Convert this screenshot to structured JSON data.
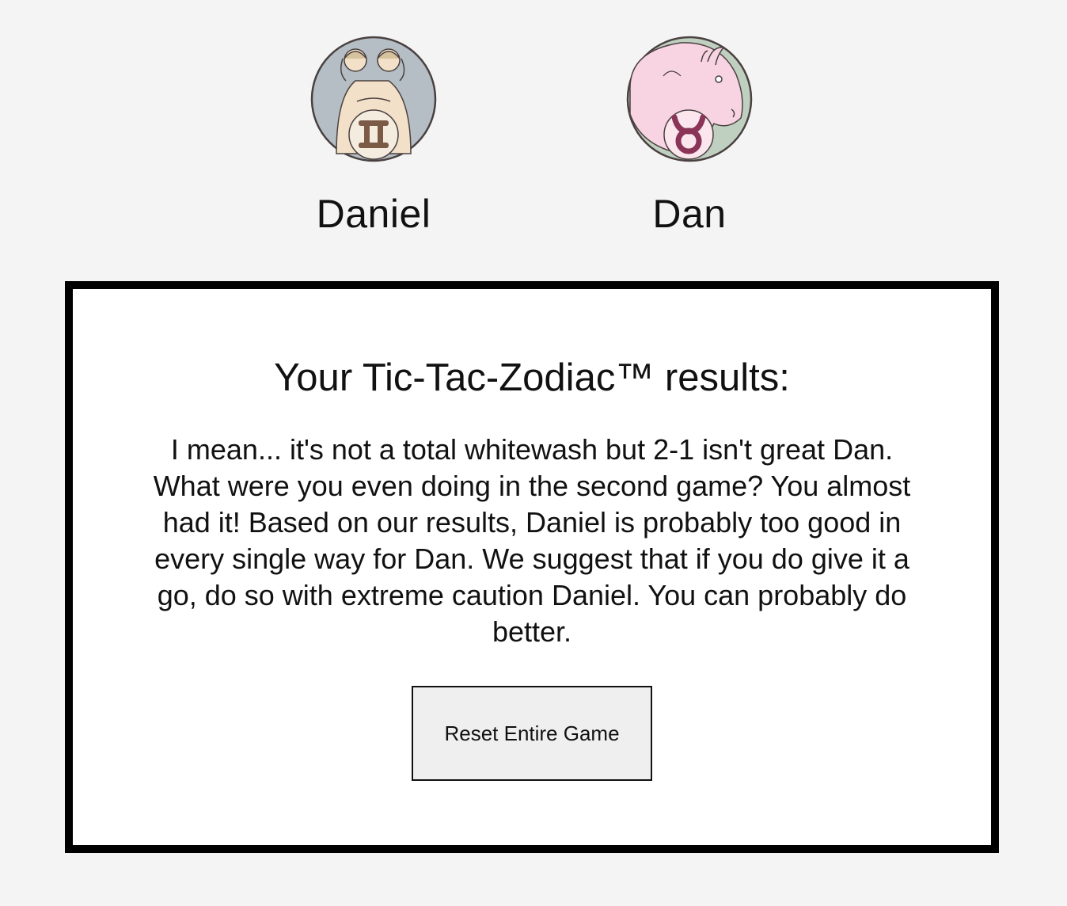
{
  "players": [
    {
      "name": "Daniel",
      "sign_icon": "gemini-icon",
      "avatar_bg": "#b4bec4",
      "avatar_accent": "#7b5a46"
    },
    {
      "name": "Dan",
      "sign_icon": "taurus-icon",
      "avatar_bg": "#bfd0c0",
      "avatar_accent": "#8a3458"
    }
  ],
  "results": {
    "title": "Your Tic-Tac-Zodiac™ results:",
    "message": "I mean... it's not a total whitewash but 2-1 isn't great Dan. What were you even doing in the second game? You almost had it! Based on our results, Daniel is probably too good in every single way for Dan. We suggest that if you do give it a go, do so with extreme caution Daniel. You can probably do better.",
    "reset_label": "Reset Entire Game"
  }
}
